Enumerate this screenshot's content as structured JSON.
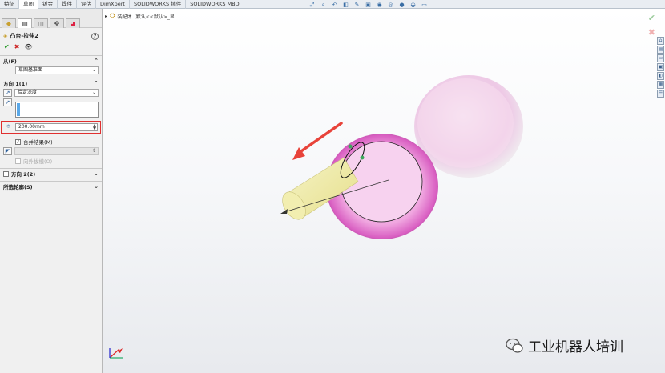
{
  "command_tabs": [
    "特征",
    "草图",
    "钣金",
    "焊件",
    "评估",
    "DimXpert",
    "SOLIDWORKS 插件",
    "SOLIDWORKS MBD"
  ],
  "active_tab_index": 1,
  "view_toolbar_icons": [
    "zoom-to-fit-icon",
    "zoom-area-icon",
    "previous-view-icon",
    "section-view-icon",
    "dynamic-annotation-icon",
    "view-orientation-icon",
    "display-style-icon",
    "hide-show-icon",
    "appearance-icon",
    "scene-icon",
    "display-settings-icon"
  ],
  "feature_tree": {
    "root_label": "装配体",
    "path_label": "(默认<<默认>_显..."
  },
  "property_manager": {
    "panel_tabs": [
      "feature-manager-icon",
      "property-manager-icon",
      "configuration-manager-icon",
      "dimxpert-icon",
      "display-manager-icon"
    ],
    "feature_name": "凸台-拉伸2",
    "from_section": {
      "title": "从(F)",
      "value": "草图基准面"
    },
    "direction1": {
      "title": "方向 1(1)",
      "end_condition": "给定深度",
      "depth_value": "200.00mm",
      "merge_result_label": "合并结果(M)",
      "merge_result_checked": true,
      "draft_outward_label": "向外拔模(O)",
      "draft_outward_checked": false
    },
    "direction2": {
      "title": "方向 2(2)",
      "checked": false
    },
    "selected_contours": {
      "title": "所选轮廓(S)"
    }
  },
  "right_task_icons": [
    "home-icon",
    "parts-library-icon",
    "file-explorer-icon",
    "view-palette-icon",
    "appearances-icon",
    "custom-properties-icon",
    "forum-icon"
  ],
  "watermark_text": "工业机器人培训",
  "colors": {
    "sphere_pink": "#e57fd0",
    "ghost_pink": "#ecc3e3",
    "extrude_yellow": "#eeeaa0",
    "highlight_red": "#e03030",
    "arrow_red": "#e8433a"
  }
}
